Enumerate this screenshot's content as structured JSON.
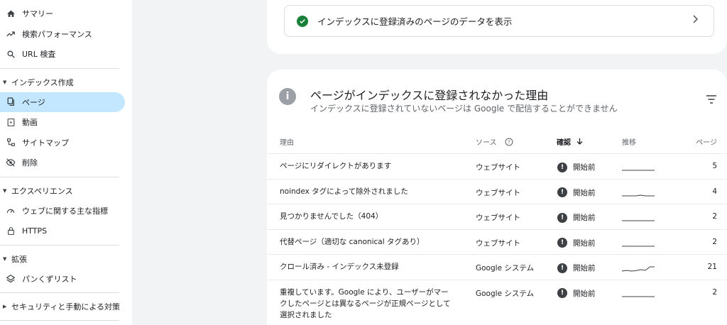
{
  "sidebar": {
    "items_top": [
      {
        "label": "サマリー",
        "icon": "home-icon"
      },
      {
        "label": "検索パフォーマンス",
        "icon": "trending-icon"
      },
      {
        "label": "URL 検査",
        "icon": "search-icon"
      }
    ],
    "sections": [
      {
        "label": "インデックス作成",
        "items": [
          {
            "label": "ページ",
            "icon": "pages-icon",
            "active": true
          },
          {
            "label": "動画",
            "icon": "video-icon"
          },
          {
            "label": "サイトマップ",
            "icon": "sitemap-icon"
          },
          {
            "label": "削除",
            "icon": "eye-off-icon"
          }
        ]
      },
      {
        "label": "エクスペリエンス",
        "items": [
          {
            "label": "ウェブに関する主な指標",
            "icon": "gauge-icon"
          },
          {
            "label": "HTTPS",
            "icon": "lock-icon"
          }
        ]
      },
      {
        "label": "拡張",
        "items": [
          {
            "label": "パンくずリスト",
            "icon": "layers-icon"
          }
        ]
      },
      {
        "label": "セキュリティと手動による対策",
        "items": []
      }
    ]
  },
  "index_link": {
    "label": "インデックスに登録済みのページのデータを表示"
  },
  "not_indexed": {
    "title": "ページがインデックスに登録されなかった理由",
    "subtitle": "インデックスに登録されていないページは Google で配信することができません",
    "columns": {
      "reason": "理由",
      "source": "ソース",
      "validation": "確認",
      "trend": "推移",
      "pages": "ページ"
    },
    "rows": [
      {
        "reason": "ページにリダイレクトがあります",
        "source": "ウェブサイト",
        "status": "開始前",
        "pages": "5",
        "trend": [
          0,
          0,
          0,
          0,
          0,
          0,
          0,
          0
        ]
      },
      {
        "reason": "noindex タグによって除外されました",
        "source": "ウェブサイト",
        "status": "開始前",
        "pages": "4",
        "trend": [
          0,
          0,
          0,
          0,
          0.1,
          0,
          0,
          0
        ]
      },
      {
        "reason": "見つかりませんでした（404）",
        "source": "ウェブサイト",
        "status": "開始前",
        "pages": "2",
        "trend": [
          0,
          0,
          0,
          0,
          0,
          0,
          0,
          0
        ]
      },
      {
        "reason": "代替ページ（適切な canonical タグあり）",
        "source": "ウェブサイト",
        "status": "開始前",
        "pages": "2",
        "trend": [
          0,
          0,
          0,
          0,
          0,
          0,
          0,
          0
        ]
      },
      {
        "reason": "クロール済み - インデックス未登録",
        "source": "Google システム",
        "status": "開始前",
        "pages": "21",
        "trend": [
          0,
          0.1,
          0,
          0.05,
          0.2,
          0.1,
          0.6,
          0.6
        ]
      },
      {
        "reason": "重複しています。Google により、ユーザーがマークしたページとは異なるページが正規ページとして選択されました",
        "source": "Google システム",
        "status": "開始前",
        "pages": "2",
        "trend": [
          0,
          0,
          0,
          0,
          0,
          0,
          0,
          0
        ]
      }
    ]
  },
  "colors": {
    "active_bg": "#c2e7ff",
    "success": "#188038",
    "page_bg": "#f1f3f4"
  }
}
